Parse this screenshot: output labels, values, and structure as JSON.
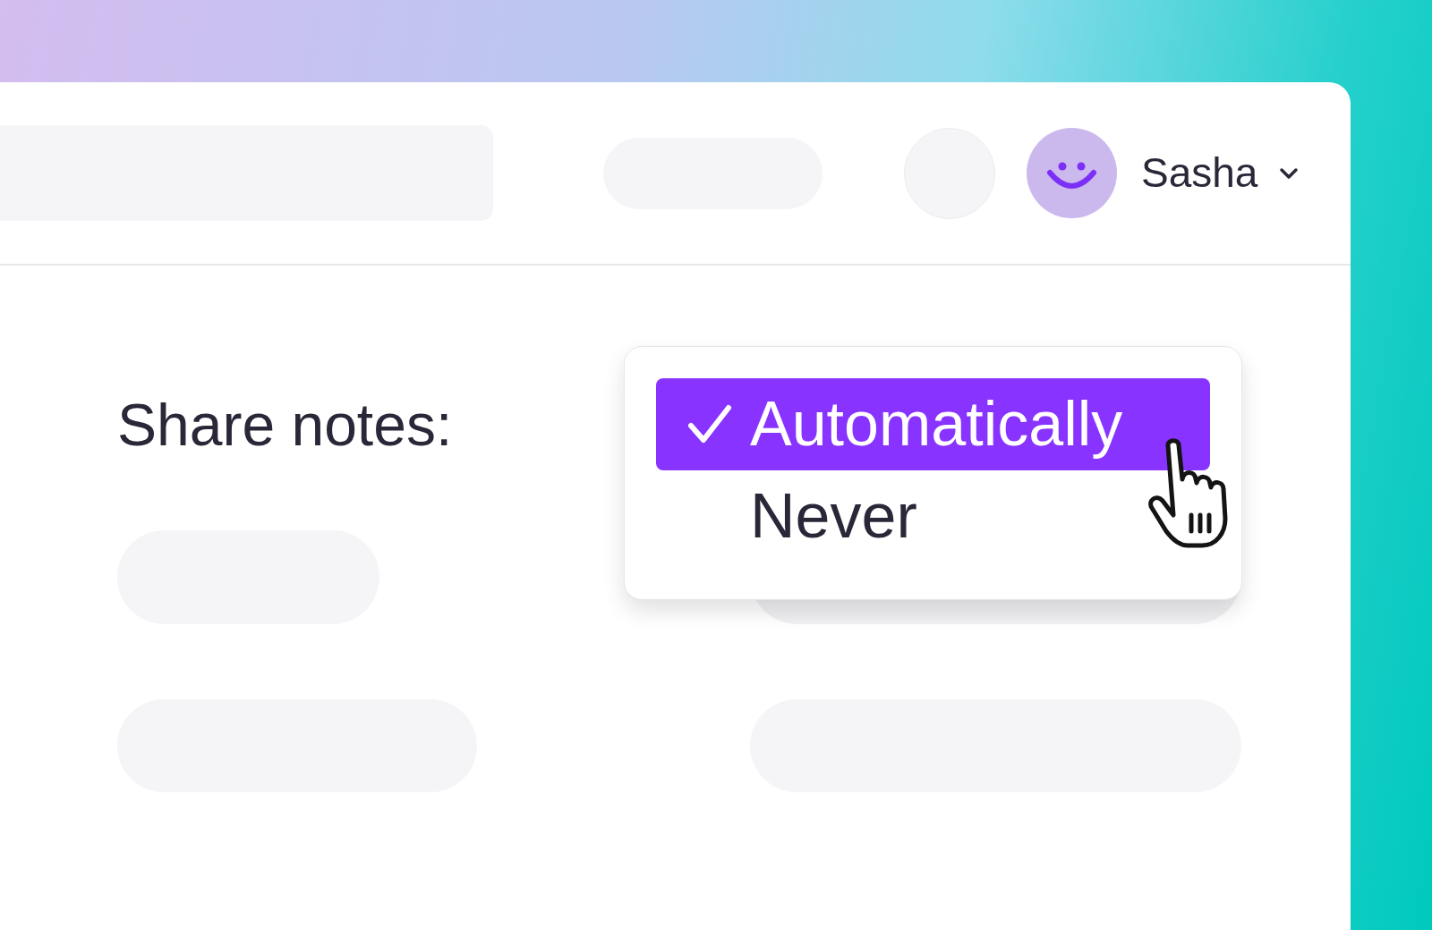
{
  "user": {
    "name": "Sasha"
  },
  "setting": {
    "label": "Share notes:"
  },
  "dropdown": {
    "options": [
      {
        "label": "Automatically",
        "selected": true
      },
      {
        "label": "Never",
        "selected": false
      }
    ]
  }
}
